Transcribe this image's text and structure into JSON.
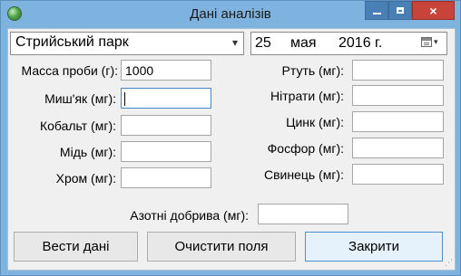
{
  "window": {
    "title": "Дані аналізів",
    "icon": "globe-icon",
    "controls": {
      "minimize": "minimize-icon",
      "maximize": "maximize-icon",
      "close": "×"
    }
  },
  "location_combo": {
    "value": "Стрийський парк",
    "arrow": "▾"
  },
  "date_picker": {
    "day": "25",
    "month": "мая",
    "year": "2016 г.",
    "button_arrow": "▾"
  },
  "left_fields": [
    {
      "label": "Масса проби (г):",
      "value": "1000"
    },
    {
      "label": "Миш'як (мг):",
      "value": ""
    },
    {
      "label": "Кобальт (мг):",
      "value": ""
    },
    {
      "label": "Мідь (мг):",
      "value": ""
    },
    {
      "label": "Хром (мг):",
      "value": ""
    }
  ],
  "right_fields": [
    {
      "label": "Ртуть (мг):",
      "value": ""
    },
    {
      "label": "Нітрати (мг):",
      "value": ""
    },
    {
      "label": "Цинк (мг):",
      "value": ""
    },
    {
      "label": "Фосфор (мг):",
      "value": ""
    },
    {
      "label": "Свинець (мг):",
      "value": ""
    }
  ],
  "nitrogen_field": {
    "label": "Азотні добрива (мг):",
    "value": ""
  },
  "buttons": {
    "enter": "Вести дані",
    "clear": "Очистити поля",
    "close": "Закрити"
  },
  "colors": {
    "titlebar": "#7fb3df",
    "close_button": "#c7443a",
    "client_bg": "#f0f0f0",
    "focus_border": "#3f87c9"
  }
}
